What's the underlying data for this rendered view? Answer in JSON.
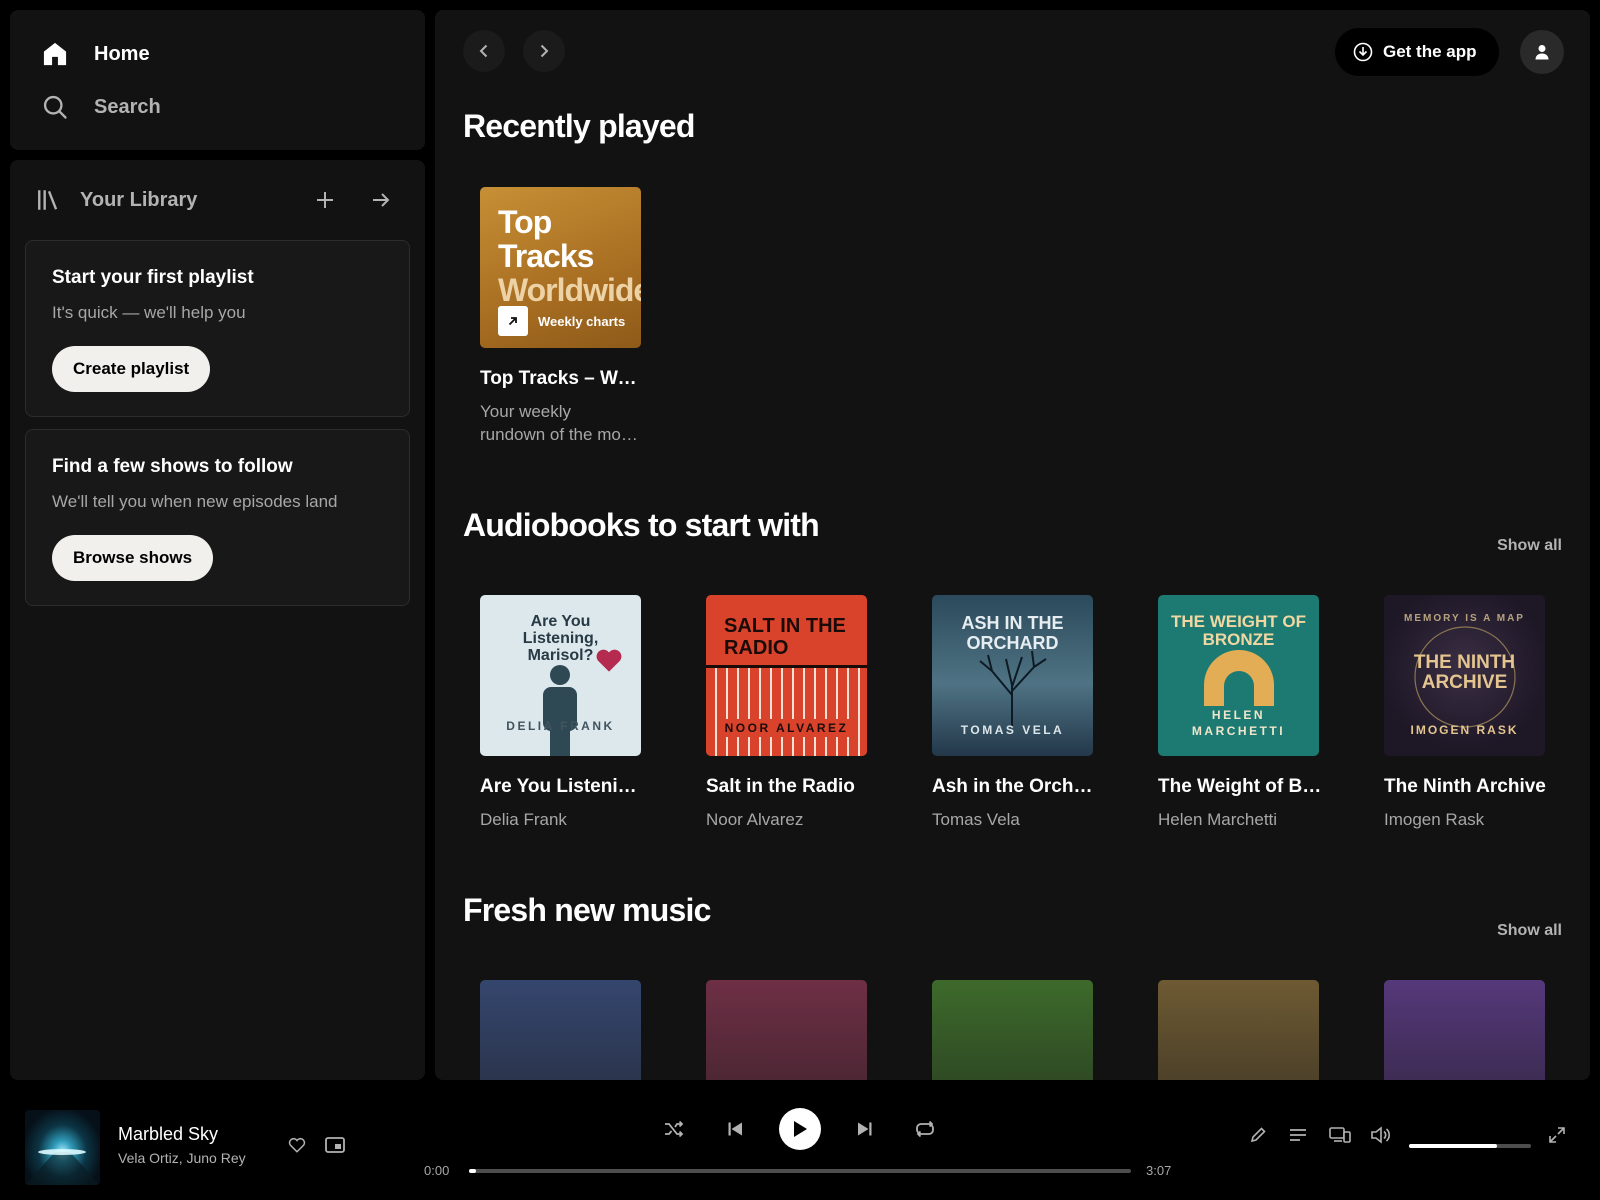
{
  "sidebar": {
    "nav": [
      {
        "label": "Home",
        "icon": "home-icon"
      },
      {
        "label": "Search",
        "icon": "search-icon"
      }
    ],
    "library": {
      "title": "Your Library",
      "cards": [
        {
          "title": "Start your first playlist",
          "subtitle": "It's quick — we'll help you",
          "button": "Create playlist"
        },
        {
          "title": "Find a few shows to follow",
          "subtitle": "We'll tell you when new episodes land",
          "button": "Browse shows"
        }
      ]
    }
  },
  "header": {
    "get_app": "Get the app"
  },
  "sections": {
    "recently_played": {
      "title": "Recently played",
      "items": [
        {
          "title": "Top Tracks – Worldwide",
          "subtitle": "Your weekly rundown of the most played songs",
          "cover_line1": "Top",
          "cover_line2": "Tracks",
          "cover_line3": "Worldwide",
          "cover_badge": "Weekly charts"
        }
      ]
    },
    "audiobooks": {
      "title": "Audiobooks to start with",
      "show_all": "Show all",
      "items": [
        {
          "title": "Are You Listening, Marisol?",
          "author": "Delia Frank",
          "cover_title": "Are You Listening, Marisol?",
          "cover_author": "DELIA FRANK"
        },
        {
          "title": "Salt in the Radio",
          "author": "Noor Alvarez",
          "cover_title": "SALT IN THE RADIO",
          "cover_author": "NOOR ALVAREZ"
        },
        {
          "title": "Ash in the Orchard",
          "author": "Tomas Vela",
          "cover_title": "ASH IN THE ORCHARD",
          "cover_author": "TOMAS VELA"
        },
        {
          "title": "The Weight of Bronze",
          "author": "Helen Marchetti",
          "cover_title": "THE WEIGHT OF BRONZE",
          "cover_author": "HELEN MARCHETTI"
        },
        {
          "title": "The Ninth Archive",
          "author": "Imogen Rask",
          "cover_title": "THE NINTH ARCHIVE",
          "cover_author": "IMOGEN RASK",
          "cover_kicker": "MEMORY IS A MAP"
        }
      ]
    },
    "fresh_music": {
      "title": "Fresh new music",
      "show_all": "Show all",
      "colors": [
        "#35466e",
        "#6e2f45",
        "#3d6a2b",
        "#6e5a33",
        "#55387a"
      ]
    }
  },
  "player": {
    "track": "Marbled Sky",
    "artists": "Vela Ortiz, Juno Rey",
    "elapsed": "0:00",
    "duration": "3:07",
    "progress": 0.01,
    "volume": 0.72
  },
  "colors": {
    "background": "#000000",
    "panel": "#121212",
    "text_primary": "#ffffff",
    "text_secondary": "#b3b3b3"
  }
}
